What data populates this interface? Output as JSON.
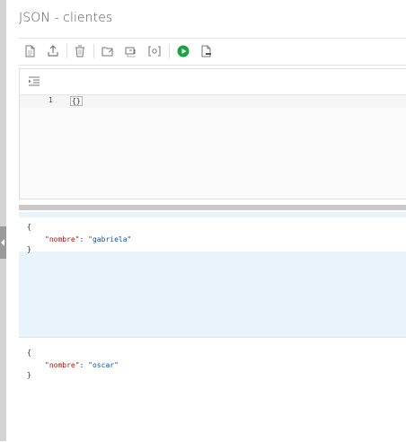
{
  "window": {
    "title": "JSON - clientes"
  },
  "toolbar": {
    "buttons": [
      {
        "name": "new-document-icon"
      },
      {
        "name": "export-icon"
      },
      {
        "name": "delete-icon"
      },
      {
        "name": "open-folder-icon"
      },
      {
        "name": "format-icon"
      },
      {
        "name": "code-brackets-icon"
      },
      {
        "name": "run-icon",
        "color": "#1aa340"
      },
      {
        "name": "sql-file-icon"
      }
    ]
  },
  "editor": {
    "format_icon": "indent-icon",
    "lines": [
      {
        "number": "1",
        "code": "{}"
      }
    ]
  },
  "results": [
    {
      "open": "{",
      "key": "\"nombre\"",
      "colon": ": ",
      "value": "\"gabriela\"",
      "close": "}"
    },
    {
      "open": "{",
      "key": "\"nombre\"",
      "colon": ": ",
      "value": "\"oscar\"",
      "close": "}"
    }
  ],
  "colors": {
    "json_key": "#a31515",
    "json_value": "#0b5394",
    "selected_row": "#e8f3fb"
  }
}
